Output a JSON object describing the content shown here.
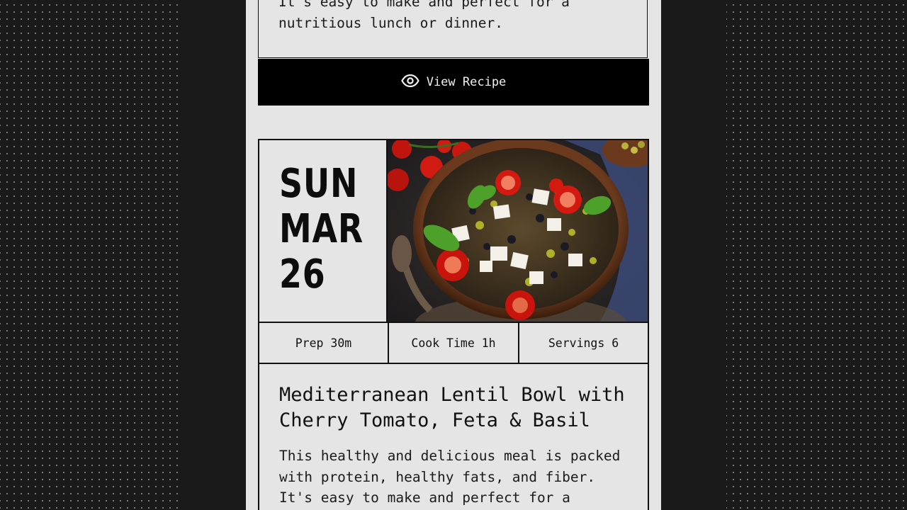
{
  "previous_card": {
    "description": "It's easy to make and perfect for a\nnutritious lunch or dinner.",
    "view_recipe_label": "View Recipe",
    "view_icon": "eye-icon"
  },
  "recipe_card": {
    "date": {
      "day": "SUN",
      "month": "MAR",
      "date": "26"
    },
    "image": {
      "description_icon": "lentil-bowl-photo"
    },
    "stats": {
      "prep": "Prep 30m",
      "cook_time": "Cook Time 1h",
      "servings": "Servings 6"
    },
    "title": "Mediterranean Lentil Bowl with Cherry Tomato, Feta & Basil",
    "description": "This healthy and delicious meal is packed with protein, healthy fats, and fiber. It's easy to make and perfect for a"
  },
  "colors": {
    "page_background": "#1a1a1a",
    "panel_background": "#e5e5e5",
    "button_background": "#000000",
    "text": "#111111"
  }
}
